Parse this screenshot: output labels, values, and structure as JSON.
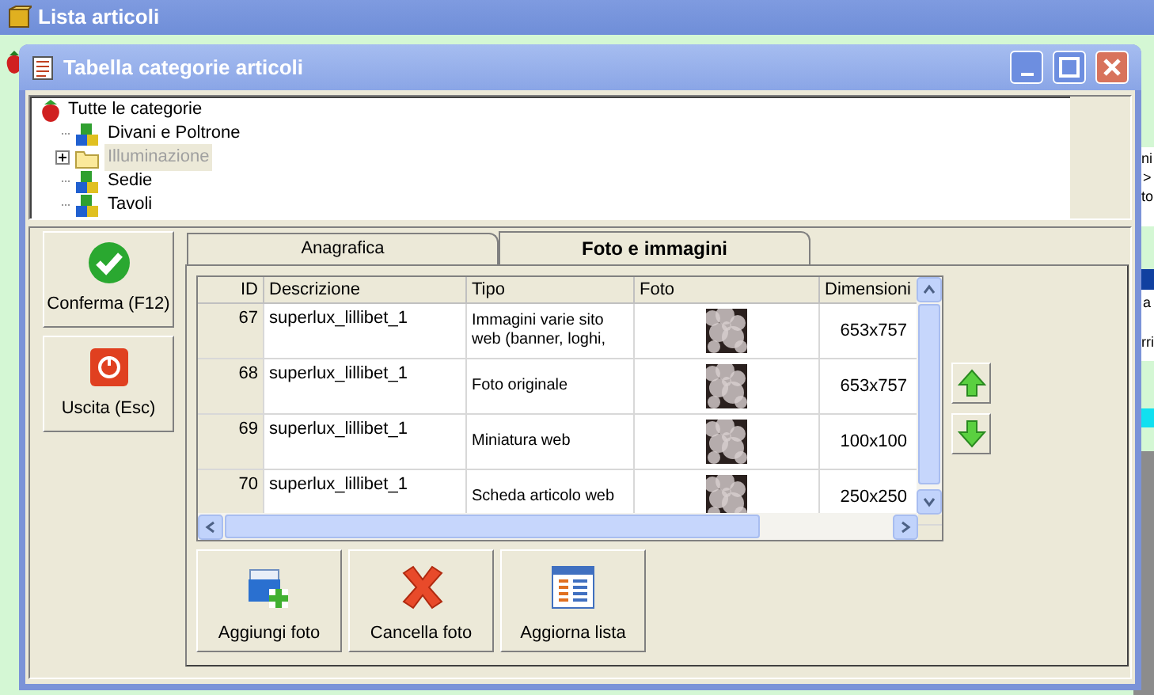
{
  "background_window": {
    "title": "Lista articoli",
    "edge_texts": [
      "ni",
      ">",
      "to",
      "a",
      "rri"
    ]
  },
  "dialog": {
    "title": "Tabella categorie articoli"
  },
  "category_tree": {
    "label": "Tutte le categorie",
    "children": [
      {
        "label": "Divani e Poltrone",
        "expandable": false,
        "selected": false
      },
      {
        "label": "Illuminazione",
        "expandable": true,
        "selected": true
      },
      {
        "label": "Sedie",
        "expandable": false,
        "selected": false
      },
      {
        "label": "Tavoli",
        "expandable": false,
        "selected": false
      }
    ]
  },
  "side_buttons": [
    {
      "label": "Conferma (F12)",
      "kind": "confirm"
    },
    {
      "label": "Uscita (Esc)",
      "kind": "exit"
    }
  ],
  "tabs": [
    {
      "label": "Anagrafica",
      "selected": false
    },
    {
      "label": "Foto e immagini",
      "selected": true
    }
  ],
  "photo_table": {
    "columns": [
      "ID",
      "Descrizione",
      "Tipo",
      "Foto",
      "Dimensioni"
    ],
    "rows": [
      {
        "id": "67",
        "description": "superlux_lillibet_1",
        "type": "Immagini varie sito web (banner, loghi,",
        "size": "653x757"
      },
      {
        "id": "68",
        "description": "superlux_lillibet_1",
        "type": "Foto originale",
        "size": "653x757"
      },
      {
        "id": "69",
        "description": "superlux_lillibet_1",
        "type": "Miniatura web",
        "size": "100x100"
      },
      {
        "id": "70",
        "description": "superlux_lillibet_1",
        "type": "Scheda articolo web",
        "size": "250x250"
      }
    ]
  },
  "move_buttons": [
    {
      "kind": "up"
    },
    {
      "kind": "down"
    }
  ],
  "action_buttons": [
    {
      "label": "Aggiungi foto",
      "kind": "add"
    },
    {
      "label": "Cancella foto",
      "kind": "delete"
    },
    {
      "label": "Aggiorna lista",
      "kind": "refresh"
    }
  ]
}
